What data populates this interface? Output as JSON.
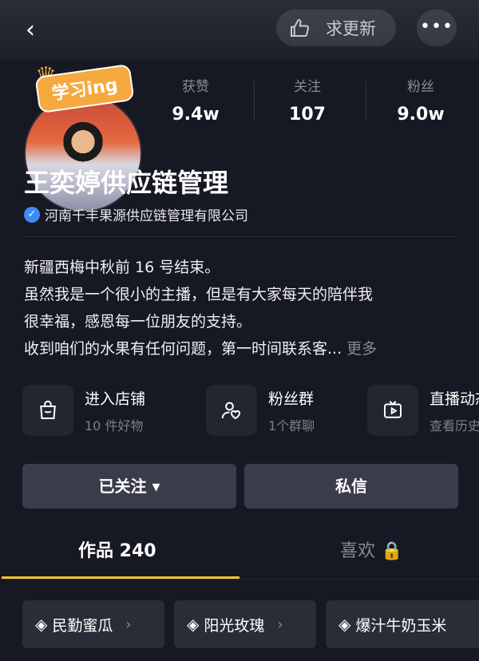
{
  "header": {
    "back_icon": "chevron-left-icon",
    "update_label": "求更新",
    "more_label": "•••"
  },
  "avatar": {
    "badge_text": "学习ing"
  },
  "stats": [
    {
      "label": "获赞",
      "value": "9.4w"
    },
    {
      "label": "关注",
      "value": "107"
    },
    {
      "label": "粉丝",
      "value": "9.0w"
    }
  ],
  "profile": {
    "name": "王奕婷供应链管理",
    "verified_text": "河南千丰果源供应链管理有限公司"
  },
  "bio": {
    "lines": [
      "新疆西梅中秋前 16 号结束。",
      "虽然我是一个很小的主播，但是有大家每天的陪伴我",
      "很幸福，感恩每一位朋友的支持。",
      "收到咱们的水果有任何问题，第一时间联系客..."
    ],
    "more_label": "更多"
  },
  "services": [
    {
      "title": "进入店铺",
      "subtitle": "10 件好物",
      "icon": "shopping-bag-icon"
    },
    {
      "title": "粉丝群",
      "subtitle": "1个群聊",
      "icon": "group-heart-icon"
    },
    {
      "title": "直播动态",
      "subtitle": "查看历史",
      "icon": "tv-play-icon"
    }
  ],
  "actions": {
    "follow_label": "已关注 ▾",
    "message_label": "私信"
  },
  "tabs": [
    {
      "label": "作品 240"
    },
    {
      "label": "喜欢 🔒"
    }
  ],
  "collections": [
    {
      "label": "民勤蜜瓜"
    },
    {
      "label": "阳光玫瑰"
    },
    {
      "label": "爆汁牛奶玉米"
    }
  ],
  "colors": {
    "background": "#161823",
    "accent": "#f7c234",
    "verified": "#3d8bf5",
    "button": "#3a3c49"
  }
}
